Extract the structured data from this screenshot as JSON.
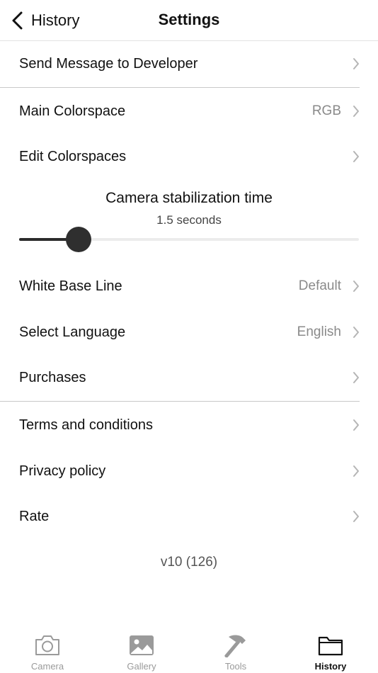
{
  "nav": {
    "back_label": "History",
    "title": "Settings"
  },
  "rows": {
    "send_message": {
      "label": "Send Message to Developer"
    },
    "main_colorspace": {
      "label": "Main Colorspace",
      "value": "RGB"
    },
    "edit_colorspaces": {
      "label": "Edit Colorspaces"
    },
    "white_base_line": {
      "label": "White Base Line",
      "value": "Default"
    },
    "select_language": {
      "label": "Select Language",
      "value": "English"
    },
    "purchases": {
      "label": "Purchases"
    },
    "terms": {
      "label": "Terms and conditions"
    },
    "privacy": {
      "label": "Privacy policy"
    },
    "rate": {
      "label": "Rate"
    }
  },
  "stabilization": {
    "title": "Camera stabilization time",
    "value_text": "1.5 seconds",
    "slider_fraction": 0.174
  },
  "version": "v10 (126)",
  "tabs": [
    {
      "label": "Camera",
      "icon": "camera-icon"
    },
    {
      "label": "Gallery",
      "icon": "image-icon"
    },
    {
      "label": "Tools",
      "icon": "hammer-icon"
    },
    {
      "label": "History",
      "icon": "folder-icon",
      "active": true
    }
  ],
  "colors": {
    "accent": "#2f2f2f",
    "chevron": "#b5b5b5",
    "inactive_tab": "#9a9a9a"
  }
}
